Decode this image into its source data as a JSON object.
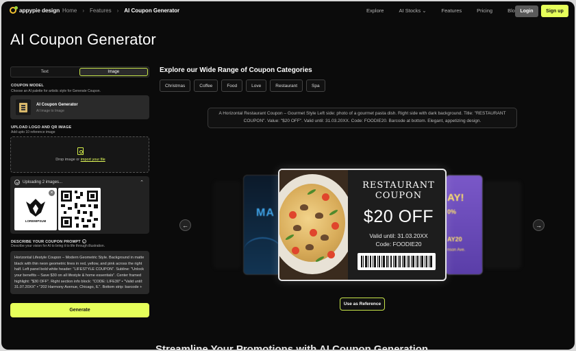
{
  "nav": {
    "logo_text": "appypie design",
    "breadcrumbs": [
      "Home",
      "Features",
      "AI Coupon Generator"
    ],
    "menu": [
      "Explore",
      "AI Stocks",
      "Features",
      "Pricing",
      "Blogs"
    ],
    "login": "Login",
    "signup": "Sign up"
  },
  "page_title": "AI Coupon Generator",
  "mode_tabs": [
    "Text",
    "Image"
  ],
  "coupon_model": {
    "label": "COUPON MODEL",
    "sub": "Choose an AI palette for artistic style for Generate Coupon.",
    "name": "AI Coupon Generator",
    "type": "AI Image to Image"
  },
  "upload": {
    "label": "UPLOAD LOGO AND QR IMAGE",
    "sub": "Add upto 10 reference image",
    "drop_text": "Drop image or ",
    "drop_link": "import your file",
    "status": "Uploading 2 images...",
    "logo_label": "LOREMIPSUM"
  },
  "prompt": {
    "label": "DESCRIBE YOUR COUPON PROMPT",
    "sub": "Describe your vision for AI to bring it to life through illustration.",
    "text": "Horizontal Lifestyle Coupon – Modern Geometric Style. Background in matte black with thin neon geometric lines in red, yellow, and pink across the right half. Left panel bold white header: \"LIFESTYLE COUPON\". Subline: \"Unlock your benefits – Save $30 on all lifestyle & home essentials\". Center framed highlight: \"$30 OFF\". Right section info block: \"CODE: LIFE30\" • \"Valid until: 31.07.20XX\" • \"202 Harmony Avenue, Chicago, IL\". Bottom strip: barcode +"
  },
  "generate": "Generate",
  "explore_title": "Explore our Wide Range of Coupon Categories",
  "categories": [
    "Christmas",
    "Coffee",
    "Food",
    "Love",
    "Restaurant",
    "Spa"
  ],
  "description": "A Horizontal Restaurant Coupon – Gourmet Style Left side: photo of a gourmet pasta dish. Right side with dark background. Title: \"RESTAURANT COUPON\". Value: \"$20 OFF\". Valid until: 31.03.20XX. Code: FOODIE20. Barcode at bottom. Elegant, appetizing design.",
  "coupon": {
    "title_line1": "RESTAURANT",
    "title_line2": "COUPON",
    "value": "$20 OFF",
    "valid": "Valid until: 31.03.20XX",
    "code": "Code: FOODIE20"
  },
  "side_cards": {
    "left_text": "MA",
    "right_line1": "AY!",
    "right_line2": "0%",
    "right_line3": "AY20",
    "right_line4": "nson Ave."
  },
  "use_reference": "Use as Reference",
  "bottom_heading": "Streamline Your Promotions with AI Coupon Generation",
  "colors": {
    "accent": "#e6ff5a",
    "background": "#0b0b0b"
  }
}
